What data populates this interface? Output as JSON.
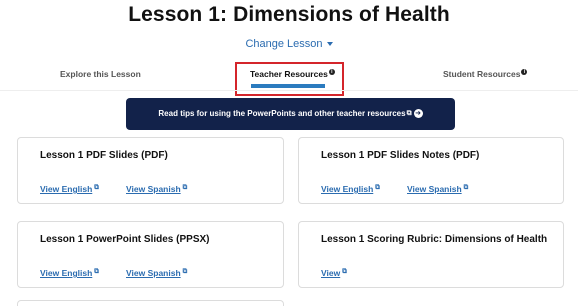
{
  "page": {
    "title": "Lesson 1: Dimensions of Health",
    "change_lesson": "Change Lesson"
  },
  "tabs": [
    {
      "label": "Explore this Lesson"
    },
    {
      "label": "Teacher Resources",
      "active": true,
      "info_icon": "info-icon"
    },
    {
      "label": "Student Resources",
      "info_icon": "info-icon"
    }
  ],
  "tips_banner": {
    "label": "Read tips for using the PowerPoints and other teacher resources",
    "icons": [
      "external-link-icon",
      "arrow-circle-right-icon"
    ]
  },
  "cards": [
    {
      "title": "Lesson 1 PDF Slides (PDF)",
      "links": [
        "View English",
        "View Spanish"
      ]
    },
    {
      "title": "Lesson 1 PDF Slides Notes (PDF)",
      "links": [
        "View English",
        "View Spanish"
      ]
    },
    {
      "title": "Lesson 1 PowerPoint Slides (PPSX)",
      "links": [
        "View English",
        "View Spanish"
      ]
    },
    {
      "title": "Lesson 1 Scoring Rubric: Dimensions of Health",
      "links": [
        "View"
      ]
    }
  ],
  "colors": {
    "link": "#2b6cb0",
    "active_tab_bar": "#2b7bbf",
    "banner_bg": "#12224a",
    "highlight_border": "#d4252b"
  }
}
